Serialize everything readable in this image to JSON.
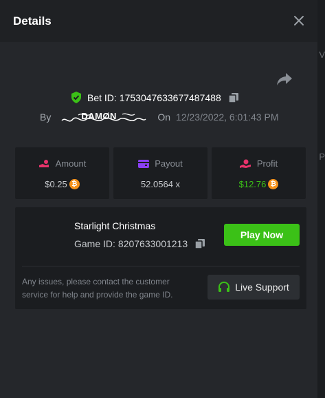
{
  "modal": {
    "title": "Details"
  },
  "bet": {
    "id_label": "Bet ID:",
    "id_value": "1753047633677487488",
    "by_label": "By",
    "username": "DAMØN",
    "on_label": "On",
    "date": "12/23/2022, 6:01:43 PM"
  },
  "stats": [
    {
      "label": "Amount",
      "value": "$0.25",
      "currency_icon": "bitcoin-icon"
    },
    {
      "label": "Payout",
      "value": "52.0564 x"
    },
    {
      "label": "Profit",
      "value": "$12.76",
      "currency_icon": "bitcoin-icon"
    }
  ],
  "game": {
    "name": "Starlight Christmas",
    "id_label": "Game ID:",
    "id_value": "8207633001213",
    "play_label": "Play Now"
  },
  "support": {
    "text": "Any issues, please contact the customer service for help and provide the game ID.",
    "button_label": "Live Support"
  },
  "background": {
    "edge_glyphs": [
      "V",
      "P"
    ]
  },
  "colors": {
    "accent_green": "#3bc117",
    "amount_icon": "#e8336b",
    "payout_icon": "#8b3ff5",
    "profit_icon": "#e8336b",
    "bitcoin": "#f7931a"
  }
}
